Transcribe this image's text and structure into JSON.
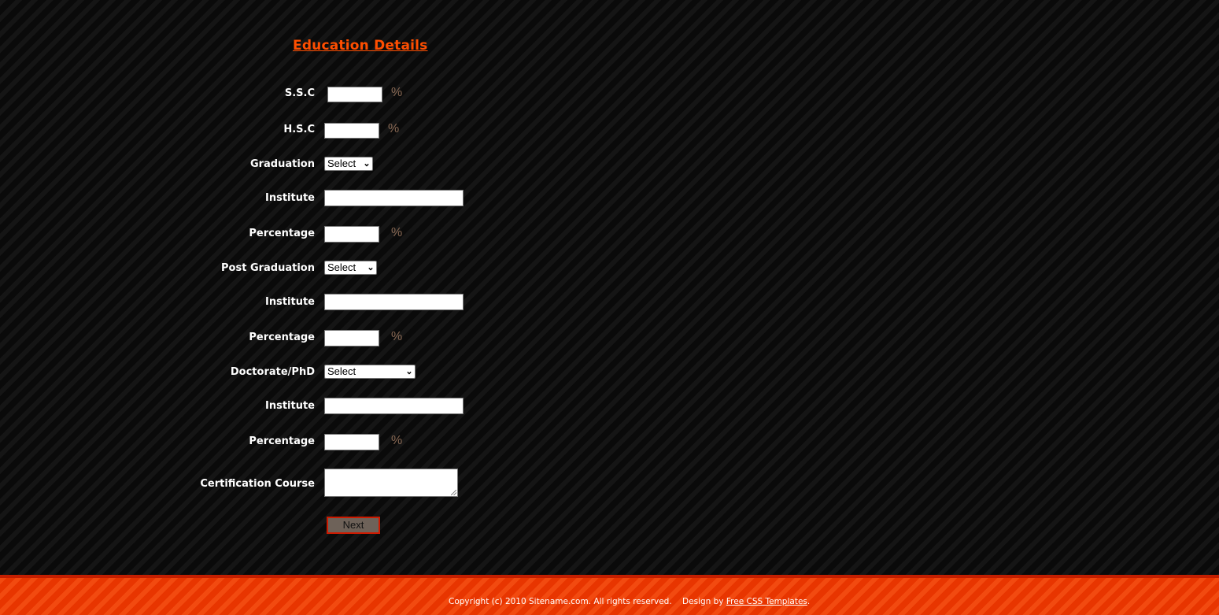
{
  "page": {
    "heading": "Education Details"
  },
  "form": {
    "ssc": {
      "label": "S.S.C",
      "value": "",
      "unit": "%"
    },
    "hsc": {
      "label": "H.S.C",
      "value": "",
      "unit": "%"
    },
    "graduation": {
      "label": "Graduation",
      "selected": "Select"
    },
    "graduation_institute": {
      "label": "Institute",
      "value": ""
    },
    "graduation_percentage": {
      "label": "Percentage",
      "value": "",
      "unit": "%"
    },
    "post_graduation": {
      "label": "Post Graduation",
      "selected": "Select"
    },
    "post_graduation_institute": {
      "label": "Institute",
      "value": ""
    },
    "post_graduation_percentage": {
      "label": "Percentage",
      "value": "",
      "unit": "%"
    },
    "doctorate": {
      "label": "Doctorate/PhD",
      "selected": "Select"
    },
    "doctorate_institute": {
      "label": "Institute",
      "value": ""
    },
    "doctorate_percentage": {
      "label": "Percentage",
      "value": "",
      "unit": "%"
    },
    "certification": {
      "label": "Certification Course",
      "value": ""
    },
    "next_label": "Next"
  },
  "footer": {
    "copyright": "Copyright (c) 2010 Sitename.com. All rights reserved.",
    "design_by": "Design by",
    "design_link": "Free CSS Templates",
    "period": "."
  },
  "colors": {
    "accent": "#ff4e00",
    "footer_bg": "#ee3a00",
    "button_border": "#cc1a00",
    "button_bg": "#6e6259"
  }
}
